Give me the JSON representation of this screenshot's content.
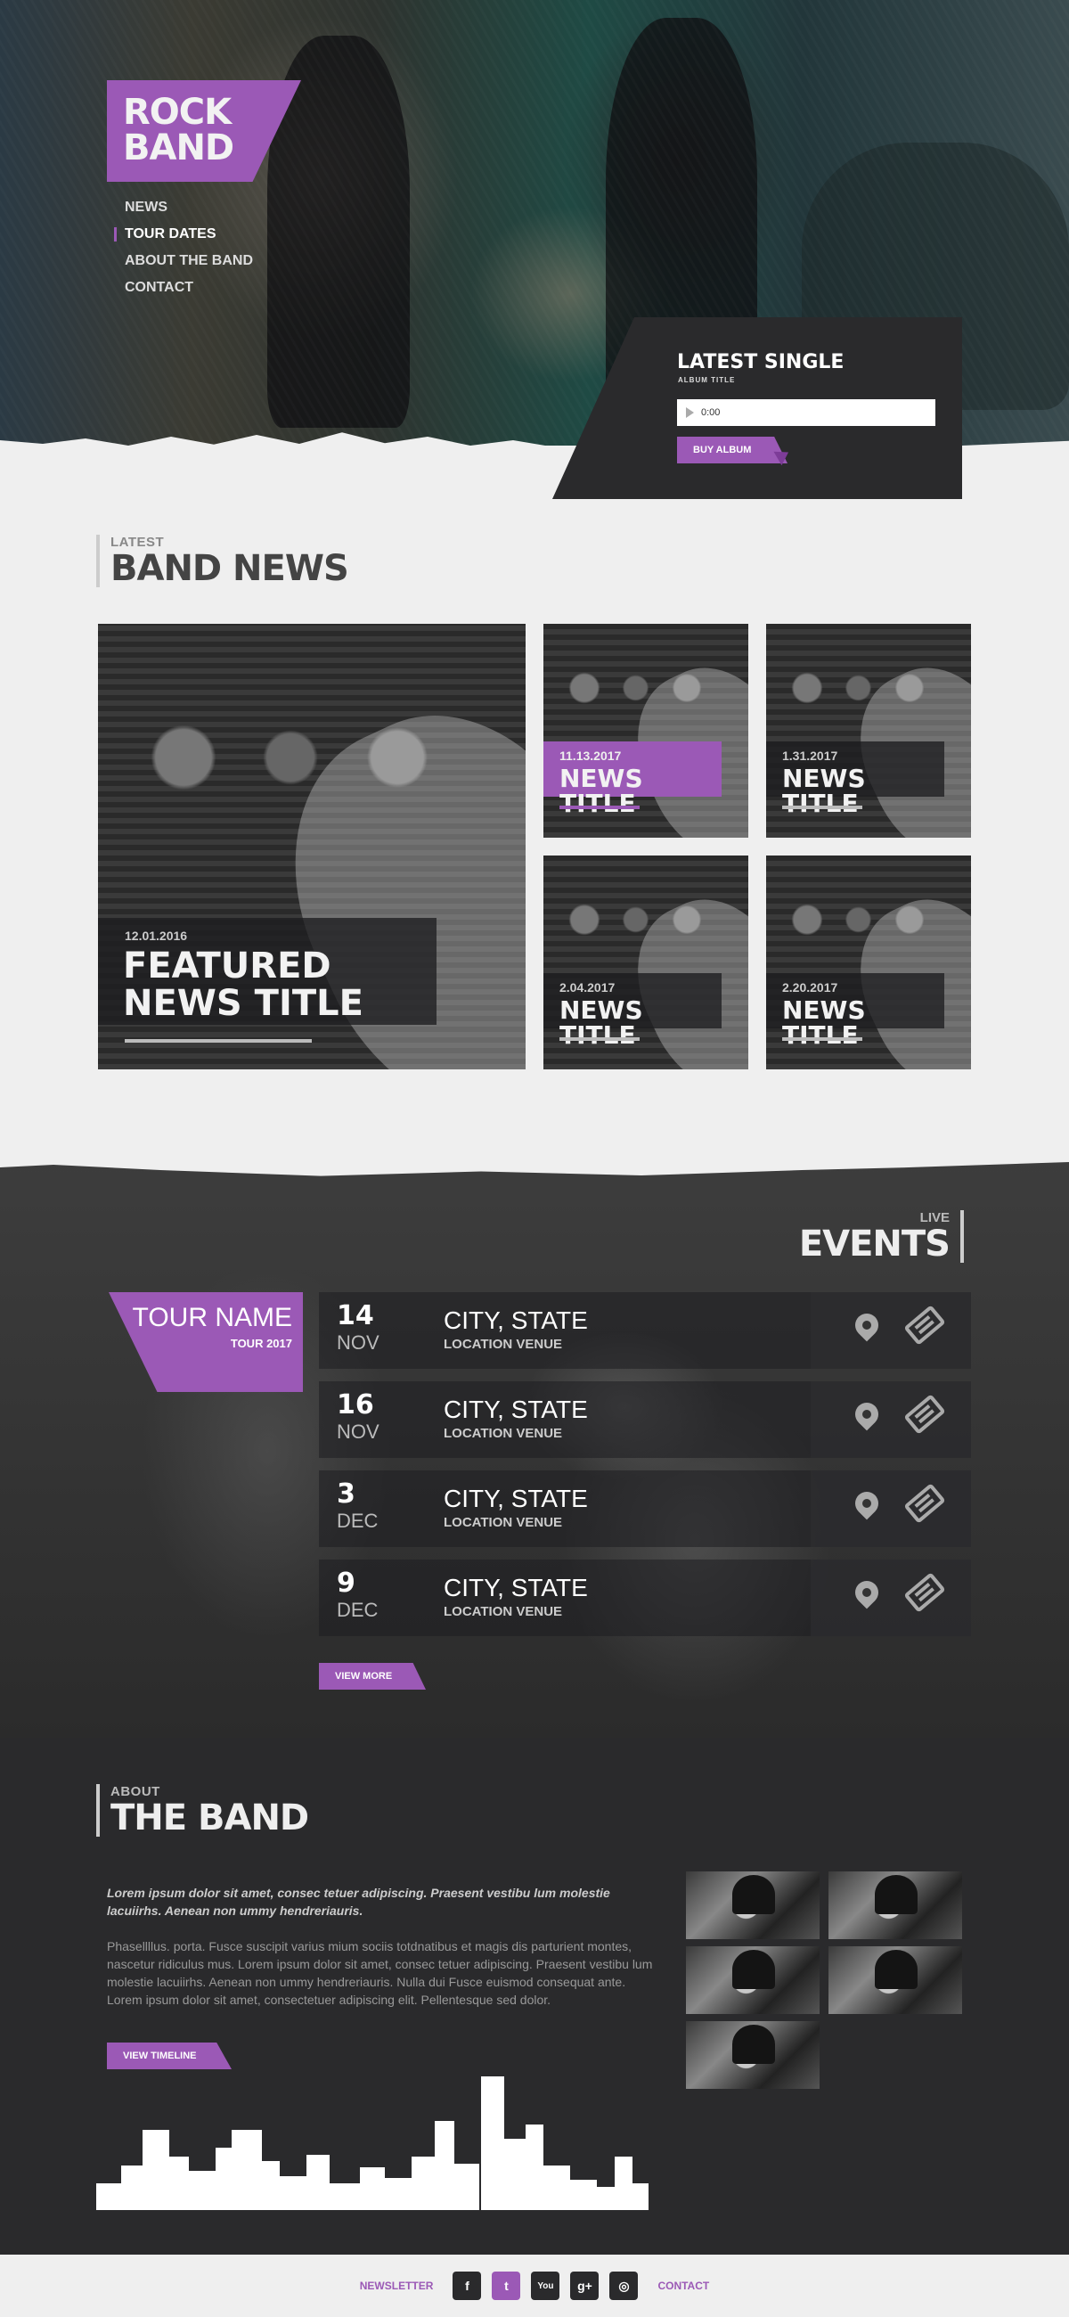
{
  "hero": {
    "logo_line1": "ROCK",
    "logo_line2": "BAND",
    "nav": [
      "NEWS",
      "TOUR DATES",
      "ABOUT THE BAND",
      "CONTACT"
    ]
  },
  "single": {
    "title": "LATEST SINGLE",
    "subtitle": "ALBUM TITLE",
    "time": "0:00",
    "buy_label": "BUY ALBUM"
  },
  "news": {
    "kicker": "LATEST",
    "heading": "BAND NEWS",
    "featured": {
      "date": "12.01.2016",
      "title_line1": "FEATURED",
      "title_line2": "NEWS TITLE"
    },
    "items": [
      {
        "date": "11.13.2017",
        "title": "NEWS TITLE"
      },
      {
        "date": "1.31.2017",
        "title": "NEWS TITLE"
      },
      {
        "date": "2.04.2017",
        "title": "NEWS TITLE"
      },
      {
        "date": "2.20.2017",
        "title": "NEWS TITLE"
      }
    ]
  },
  "events": {
    "kicker": "LIVE",
    "heading": "EVENTS",
    "tour_name": "TOUR NAME",
    "tour_year": "TOUR 2017",
    "rows": [
      {
        "day": "14",
        "month": "NOV",
        "city": "CITY, STATE",
        "venue": "LOCATION VENUE"
      },
      {
        "day": "16",
        "month": "NOV",
        "city": "CITY, STATE",
        "venue": "LOCATION VENUE"
      },
      {
        "day": "3",
        "month": "DEC",
        "city": "CITY, STATE",
        "venue": "LOCATION VENUE"
      },
      {
        "day": "9",
        "month": "DEC",
        "city": "CITY, STATE",
        "venue": "LOCATION VENUE"
      }
    ],
    "more_label": "VIEW MORE"
  },
  "about": {
    "kicker": "ABOUT",
    "heading": "THE BAND",
    "lead": "Lorem ipsum dolor sit amet, consec tetuer adipiscing. Praesent vestibu lum molestie lacuiirhs. Aenean non ummy hendreriauris.",
    "body": "Phasellllus. porta. Fusce suscipit varius mium sociis totdnatibus et magis dis parturient montes, nascetur ridiculus mus. Lorem ipsum dolor sit amet, consec tetuer adipiscing. Praesent vestibu lum molestie lacuiirhs. Aenean non ummy hendreriauris. Nulla dui Fusce euismod consequat ante. Lorem ipsum dolor sit amet, consectetuer adipiscing elit. Pellentesque sed dolor.",
    "timeline_label": "VIEW TIMELINE"
  },
  "footer": {
    "newsletter": "NEWSLETTER",
    "contact": "CONTACT",
    "social": [
      {
        "icon": "facebook-icon",
        "glyph": "f"
      },
      {
        "icon": "twitter-icon",
        "glyph": "t"
      },
      {
        "icon": "youtube-icon",
        "glyph": "You"
      },
      {
        "icon": "googleplus-icon",
        "glyph": "g+"
      },
      {
        "icon": "instagram-icon",
        "glyph": "◎"
      }
    ]
  },
  "colors": {
    "accent": "#9b59b6",
    "dark": "#2a2a2c",
    "light": "#efefef"
  }
}
